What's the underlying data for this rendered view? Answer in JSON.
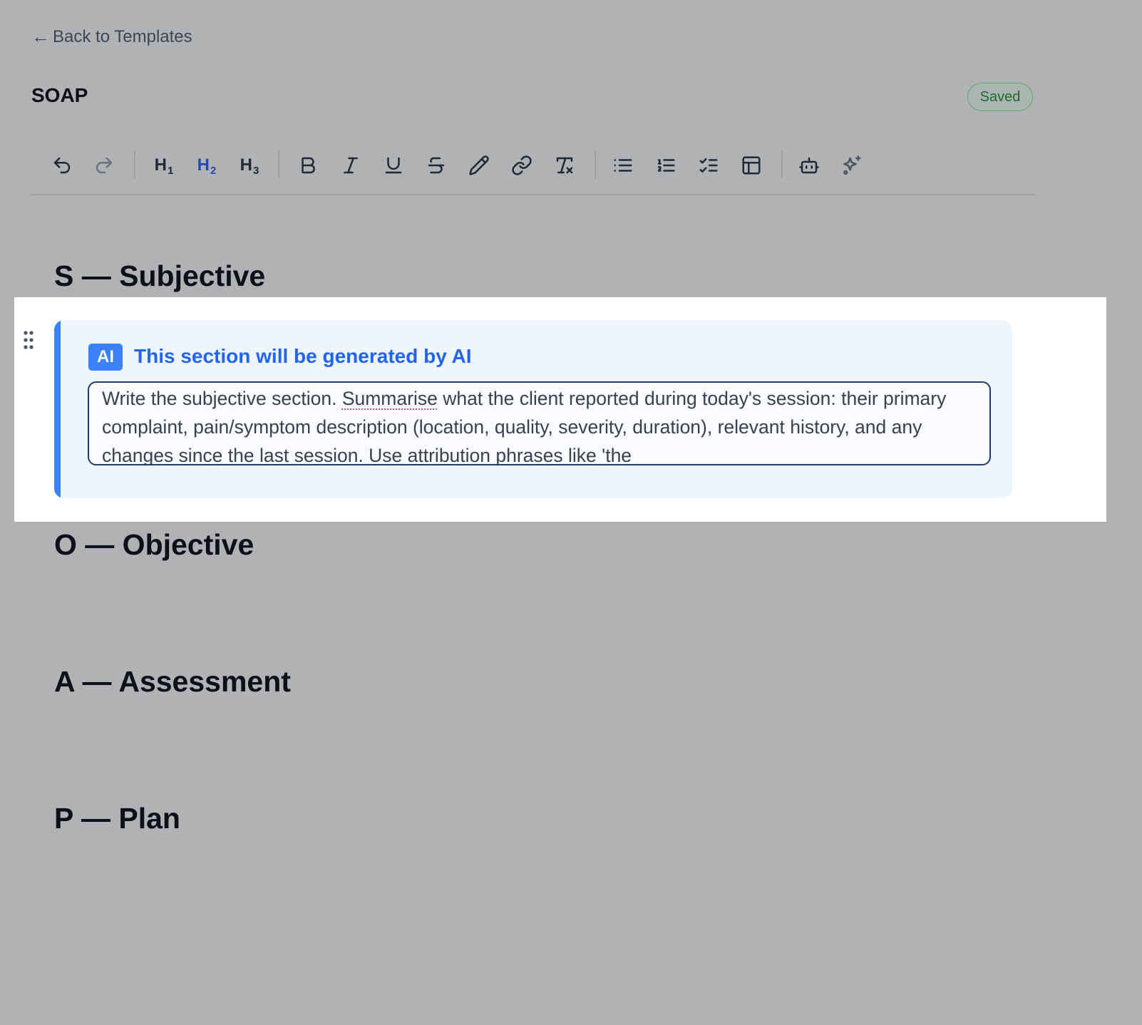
{
  "nav": {
    "back_arrow": "←",
    "back_label": "Back to Templates"
  },
  "header": {
    "title": "SOAP",
    "status": "Saved"
  },
  "toolbar": {
    "h1": "H",
    "h1_sub": "1",
    "h2": "H",
    "h2_sub": "2",
    "h3": "H",
    "h3_sub": "3",
    "active_item": "heading-2",
    "icons": [
      "undo-icon",
      "redo-icon",
      "bold-icon",
      "italic-icon",
      "underline-icon",
      "strikethrough-icon",
      "highlight-pen-icon",
      "link-icon",
      "clear-format-icon",
      "bullet-list-icon",
      "numbered-list-icon",
      "checklist-icon",
      "table-icon",
      "ai-bot-icon",
      "sparkle-icon"
    ]
  },
  "sections": {
    "subjective": "S — Subjective",
    "objective": "O — Objective",
    "assessment": "A — Assessment",
    "plan": "P — Plan"
  },
  "ai_block": {
    "badge": "AI",
    "label": "This section will be generated by AI",
    "prompt_before": "Write the subjective section. ",
    "prompt_misspelled": "Summarise",
    "prompt_after": " what the client reported during today's session: their primary complaint, pain/symptom description (location, quality, severity, duration), relevant history, and any changes since the last session. Use attribution phrases like 'the"
  },
  "colors": {
    "background": "#b1b2b4",
    "accent": "#3b82f6",
    "active_heading": "#2849b4",
    "saved": "#1d6a32"
  }
}
